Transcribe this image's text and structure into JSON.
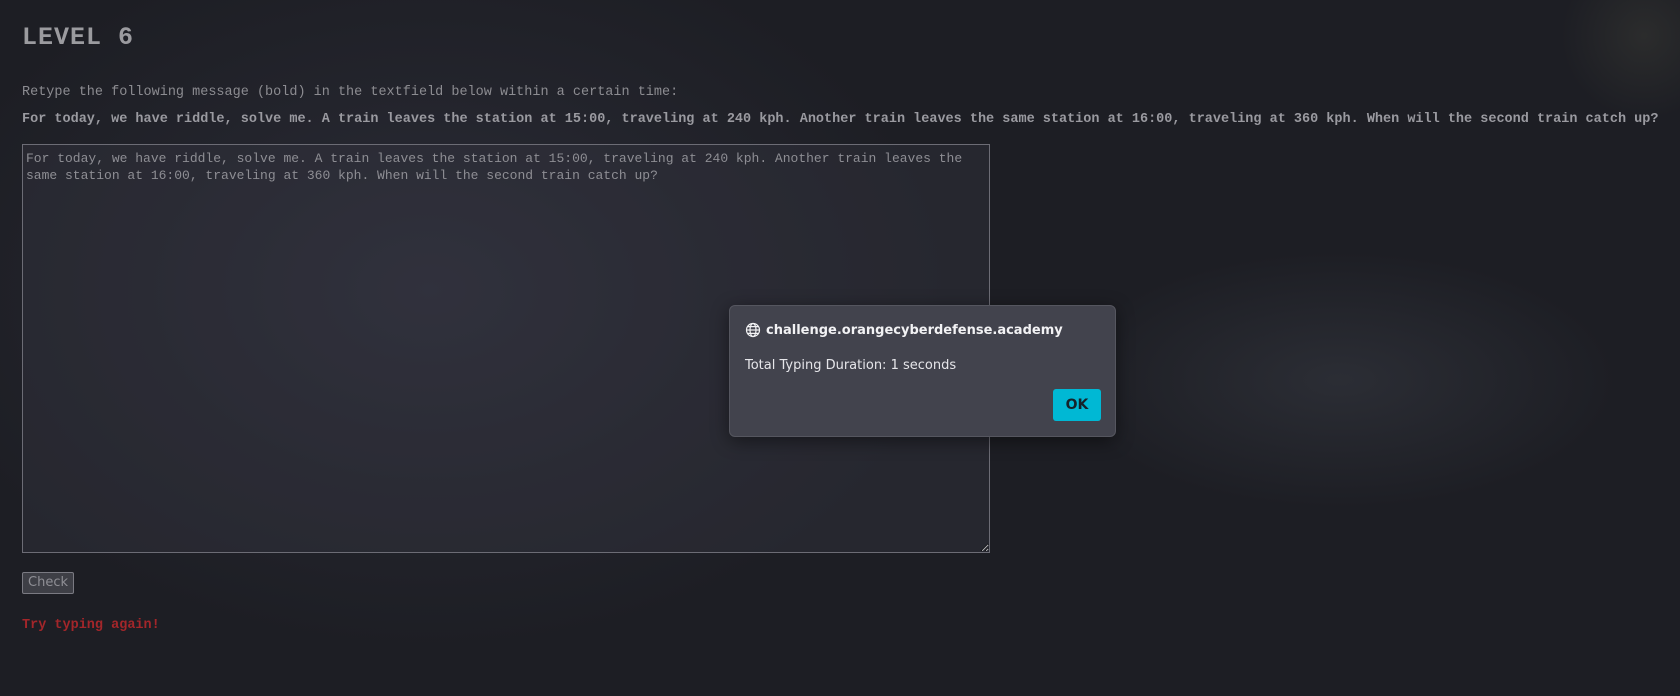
{
  "page": {
    "title": "LEVEL 6",
    "instruction": "Retype the following message (bold) in the textfield below within a certain time:",
    "message": "For today, we have riddle, solve me. A train leaves the station at 15:00, traveling at 240 kph. Another train leaves the same station at 16:00, traveling at 360 kph. When will the second train catch up?",
    "textarea_value": "For today, we have riddle, solve me. A train leaves the station at 15:00, traveling at 240 kph. Another train leaves the same station at 16:00, traveling at 360 kph. When will the second train catch up?",
    "check_label": "Check",
    "status": "Try typing again!",
    "status_color": "#a3262a"
  },
  "dialog": {
    "origin": "challenge.orangecyberdefense.academy",
    "origin_icon": "globe-icon",
    "message": "Total Typing Duration: 1 seconds",
    "ok_label": "OK",
    "accent_color": "#00b8d4"
  }
}
